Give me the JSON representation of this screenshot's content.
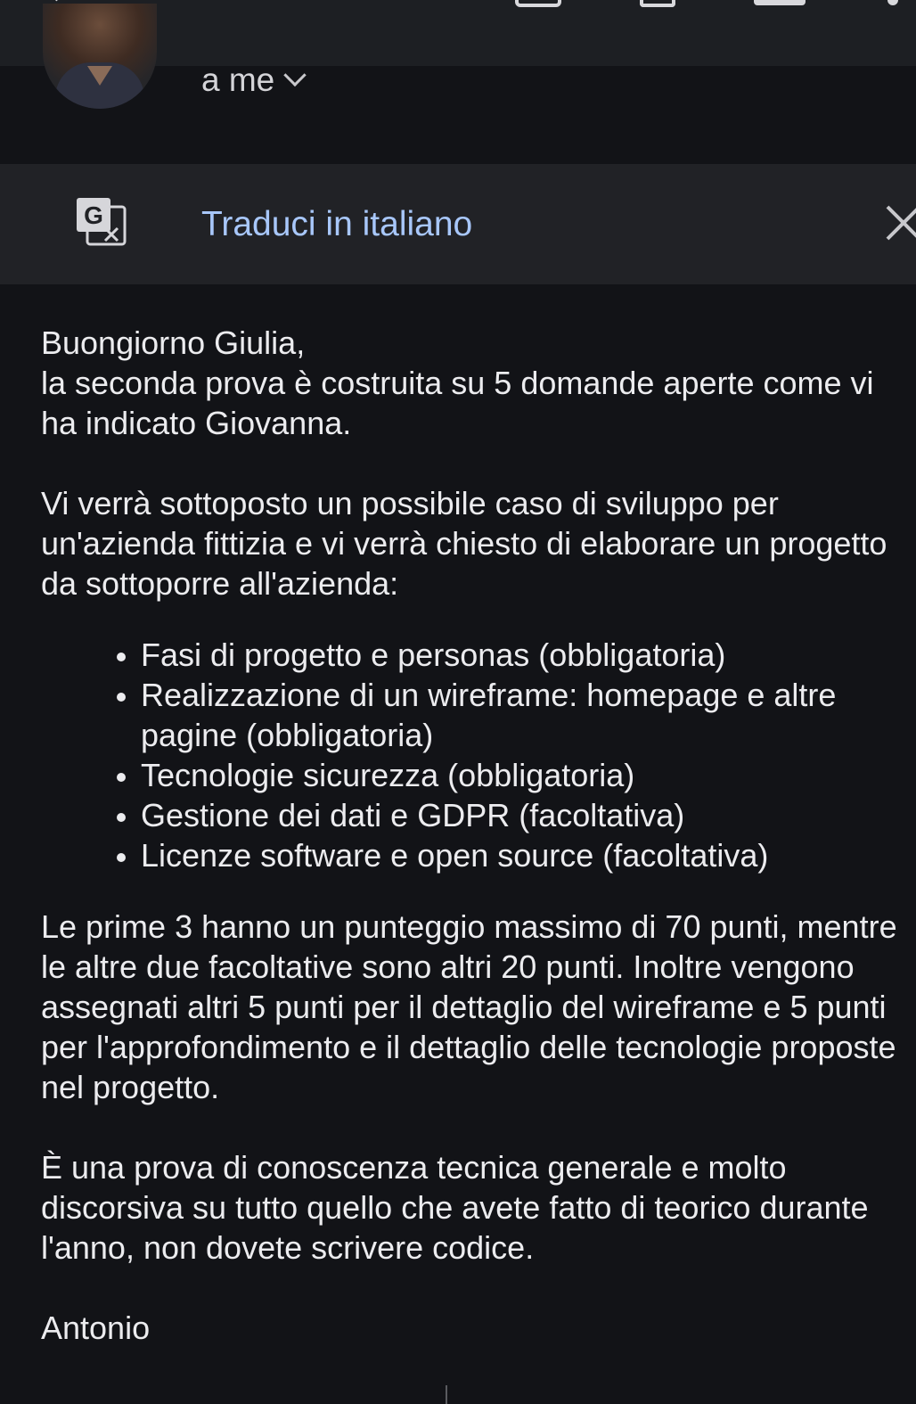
{
  "toolbar": {
    "icons": [
      "back-icon",
      "archive-icon",
      "delete-icon",
      "mark-unread-icon",
      "more-icon"
    ]
  },
  "header": {
    "recipient": "a me"
  },
  "translate": {
    "label": "Traduci in italiano"
  },
  "message": {
    "greeting": "Buongiorno Giulia,",
    "intro": "la seconda prova è costruita su 5 domande aperte come vi ha indicato Giovanna.",
    "paragraph1": "Vi verrà sottoposto un possibile caso di sviluppo per un'azienda fittizia e vi verrà chiesto di elaborare un progetto da sottoporre all'azienda:",
    "items": [
      "Fasi di progetto e personas (obbligatoria)",
      "Realizzazione di un wireframe: homepage e altre pagine (obbligatoria)",
      "Tecnologie sicurezza (obbligatoria)",
      "Gestione dei dati e GDPR (facoltativa)",
      "Licenze software e open source (facoltativa)"
    ],
    "paragraph2": "Le prime 3 hanno un punteggio massimo di 70 punti, mentre le altre due facoltative sono altri 20 punti. Inoltre vengono assegnati altri 5 punti per il dettaglio del wireframe e 5 punti per l'approfondimento e il dettaglio delle tecnologie proposte nel progetto.",
    "paragraph3": "È una prova di conoscenza tecnica generale e molto discorsiva su tutto quello che avete fatto di teorico durante l'anno, non dovete scrivere codice.",
    "signature": "Antonio"
  },
  "colors": {
    "background": "#121317",
    "toolbar": "#1d1f23",
    "translate_bar": "#212226",
    "link": "#a8c7fa",
    "text": "#ececef"
  }
}
